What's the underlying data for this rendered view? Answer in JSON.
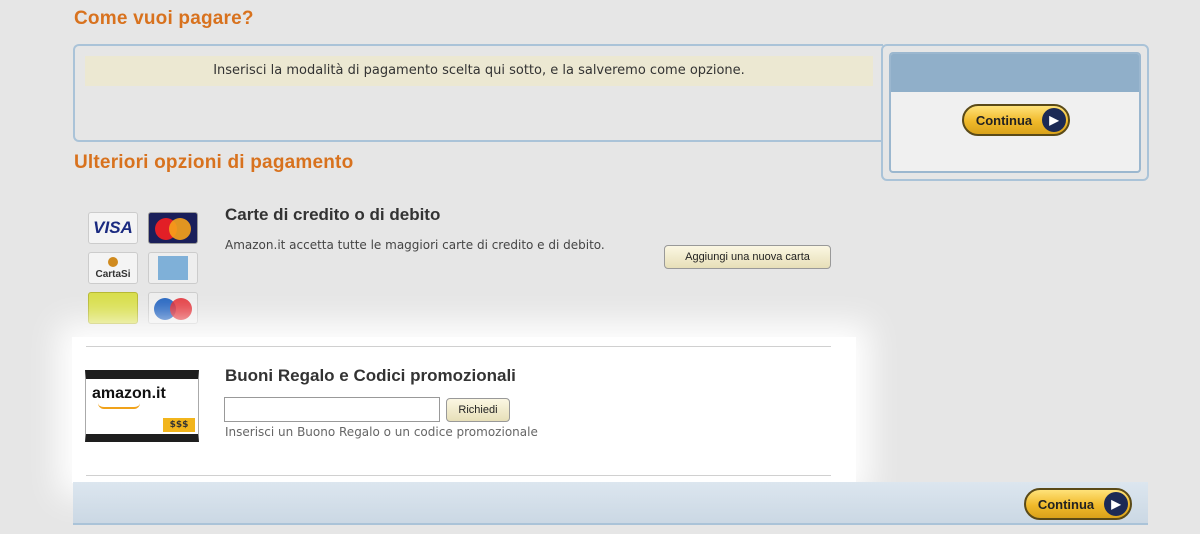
{
  "header": {
    "title": "Come vuoi pagare?"
  },
  "info": {
    "message": "Inserisci la modalità di pagamento scelta qui sotto, e la salveremo come opzione."
  },
  "continue": {
    "label": "Continua",
    "arrow": "▶"
  },
  "more_options": {
    "title": "Ulteriori opzioni di pagamento"
  },
  "cards": {
    "title": "Carte di credito o di debito",
    "description": "Amazon.it accetta tutte le maggiori carte di credito e di debito.",
    "add_button": "Aggiungi una nuova carta",
    "logos": {
      "visa": "VISA",
      "cartasi": "CartaSi"
    }
  },
  "gift": {
    "title": "Buoni Regalo e Codici promozionali",
    "input_value": "",
    "redeem_button": "Richiedi",
    "hint": "Inserisci un Buono Regalo o un codice promozionale",
    "card_logo": "amazon.it",
    "card_amount": "$$$"
  }
}
